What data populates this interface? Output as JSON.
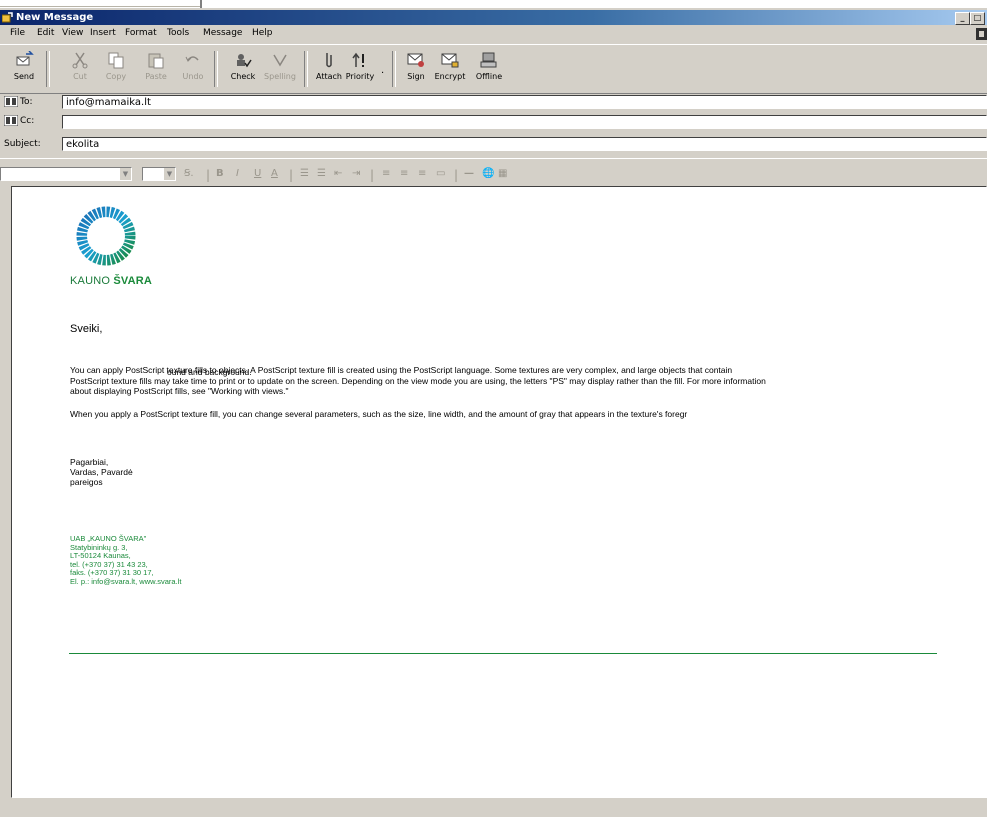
{
  "window": {
    "title": "New Message"
  },
  "menu": [
    "File",
    "Edit",
    "View",
    "Insert",
    "Format",
    "Tools",
    "Message",
    "Help"
  ],
  "toolbar": {
    "send": "Send",
    "cut": "Cut",
    "copy": "Copy",
    "paste": "Paste",
    "undo": "Undo",
    "check": "Check",
    "spelling": "Spelling",
    "attach": "Attach",
    "priority": "Priority",
    "sign": "Sign",
    "encrypt": "Encrypt",
    "offline": "Offline"
  },
  "header": {
    "to_label": "To:",
    "to_value": "info@mamaika.lt",
    "cc_label": "Cc:",
    "cc_value": "",
    "subject_label": "Subject:",
    "subject_value": "ekolita"
  },
  "body": {
    "brand_prefix": "KAUNO ",
    "brand_strong": "ŠVARA",
    "greeting": "Sveiki,",
    "para1_start": "You can apply PostScript texture fills to objects. A ",
    "para1_link1": "PostScript",
    "para1_mid": " texture fill is created using the PostScript language. Some textures are very complex, and large objects that contain PostScript texture fills may take time to print or to update on the screen. Depending on the view mode you are using, the letters \"PS\" may display rather than the fill. For more information about displaying PostScript fills, see ",
    "para1_link2": "\"Working with views.\"",
    "overlap_text": "ound and background.",
    "para2": "When you apply a PostScript texture fill, you can change several parameters, such as the size, line width, and the amount of gray that appears in the texture's foregr",
    "sig_line1": "Pagarbiai,",
    "sig_line2": "Vardas, Pavardė",
    "sig_line3": "pareigos",
    "addr_line1": "UAB „KAUNO ŠVARA\"",
    "addr_line2": "Statybininkų g. 3,",
    "addr_line3": "LT-50124 Kaunas,",
    "addr_line4": "tel. (+370 37) 31 43 23,",
    "addr_line5": "faks. (+370 37) 31 30 17,",
    "addr_line6": "El. p.: info@svara.lt, www.svara.lt"
  },
  "colors": {
    "brand_green": "#1a8a3a",
    "brand_blue": "#1b6fb5"
  }
}
